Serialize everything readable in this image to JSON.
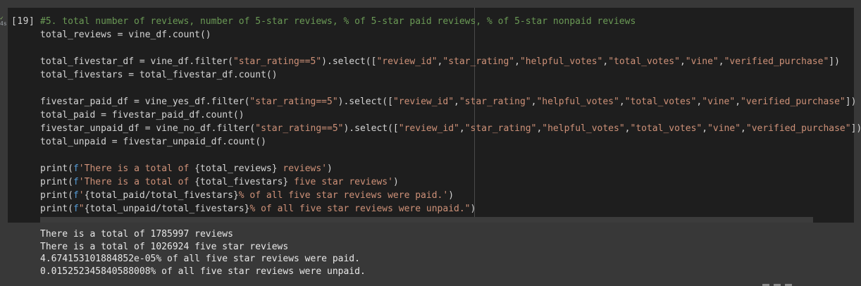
{
  "gutter": {
    "status_mark": "✓",
    "time": "4s"
  },
  "cell": {
    "execution_count": "[19]",
    "code_lines": [
      [
        {
          "t": "comment",
          "v": "#5. total number of reviews, number of 5-star reviews, % of 5-star paid reviews, % of 5-star nonpaid reviews"
        }
      ],
      [
        {
          "t": "var",
          "v": "total_reviews = vine_df.count()"
        }
      ],
      [],
      [
        {
          "t": "var",
          "v": "total_fivestar_df = vine_df.filter("
        },
        {
          "t": "str",
          "v": "\"star_rating==5\""
        },
        {
          "t": "var",
          "v": ").select(["
        },
        {
          "t": "str",
          "v": "\"review_id\""
        },
        {
          "t": "var",
          "v": ","
        },
        {
          "t": "str",
          "v": "\"star_rating\""
        },
        {
          "t": "var",
          "v": ","
        },
        {
          "t": "str",
          "v": "\"helpful_votes\""
        },
        {
          "t": "var",
          "v": ","
        },
        {
          "t": "str",
          "v": "\"total_votes\""
        },
        {
          "t": "var",
          "v": ","
        },
        {
          "t": "str",
          "v": "\"vine\""
        },
        {
          "t": "var",
          "v": ","
        },
        {
          "t": "str",
          "v": "\"verified_purchase\""
        },
        {
          "t": "var",
          "v": "])"
        }
      ],
      [
        {
          "t": "var",
          "v": "total_fivestars = total_fivestar_df.count()"
        }
      ],
      [],
      [
        {
          "t": "var",
          "v": "fivestar_paid_df = vine_yes_df.filter("
        },
        {
          "t": "str",
          "v": "\"star_rating==5\""
        },
        {
          "t": "var",
          "v": ").select(["
        },
        {
          "t": "str",
          "v": "\"review_id\""
        },
        {
          "t": "var",
          "v": ","
        },
        {
          "t": "str",
          "v": "\"star_rating\""
        },
        {
          "t": "var",
          "v": ","
        },
        {
          "t": "str",
          "v": "\"helpful_votes\""
        },
        {
          "t": "var",
          "v": ","
        },
        {
          "t": "str",
          "v": "\"total_votes\""
        },
        {
          "t": "var",
          "v": ","
        },
        {
          "t": "str",
          "v": "\"vine\""
        },
        {
          "t": "var",
          "v": ","
        },
        {
          "t": "str",
          "v": "\"verified_purchase\""
        },
        {
          "t": "var",
          "v": "])"
        }
      ],
      [
        {
          "t": "var",
          "v": "total_paid = fivestar_paid_df.count()"
        }
      ],
      [
        {
          "t": "var",
          "v": "fivestar_unpaid_df = vine_no_df.filter("
        },
        {
          "t": "str",
          "v": "\"star_rating==5\""
        },
        {
          "t": "var",
          "v": ").select(["
        },
        {
          "t": "str",
          "v": "\"review_id\""
        },
        {
          "t": "var",
          "v": ","
        },
        {
          "t": "str",
          "v": "\"star_rating\""
        },
        {
          "t": "var",
          "v": ","
        },
        {
          "t": "str",
          "v": "\"helpful_votes\""
        },
        {
          "t": "var",
          "v": ","
        },
        {
          "t": "str",
          "v": "\"total_votes\""
        },
        {
          "t": "var",
          "v": ","
        },
        {
          "t": "str",
          "v": "\"vine\""
        },
        {
          "t": "var",
          "v": ","
        },
        {
          "t": "str",
          "v": "\"verified_purchase\""
        },
        {
          "t": "var",
          "v": "])"
        }
      ],
      [
        {
          "t": "var",
          "v": "total_unpaid = fivestar_unpaid_df.count()"
        }
      ],
      [],
      [
        {
          "t": "fn",
          "v": "print("
        },
        {
          "t": "prefix",
          "v": "f"
        },
        {
          "t": "str",
          "v": "'There is a total of "
        },
        {
          "t": "var",
          "v": "{total_reviews}"
        },
        {
          "t": "str",
          "v": " reviews'"
        },
        {
          "t": "fn",
          "v": ")"
        }
      ],
      [
        {
          "t": "fn",
          "v": "print("
        },
        {
          "t": "prefix",
          "v": "f"
        },
        {
          "t": "str",
          "v": "'There is a total of "
        },
        {
          "t": "var",
          "v": "{total_fivestars}"
        },
        {
          "t": "str",
          "v": " five star reviews'"
        },
        {
          "t": "fn",
          "v": ")"
        }
      ],
      [
        {
          "t": "fn",
          "v": "print("
        },
        {
          "t": "prefix",
          "v": "f"
        },
        {
          "t": "str",
          "v": "'"
        },
        {
          "t": "var",
          "v": "{total_paid/total_fivestars}"
        },
        {
          "t": "str",
          "v": "% of all five star reviews were paid.'"
        },
        {
          "t": "fn",
          "v": ")"
        }
      ],
      [
        {
          "t": "fn",
          "v": "print("
        },
        {
          "t": "prefix",
          "v": "f"
        },
        {
          "t": "str",
          "v": "\""
        },
        {
          "t": "var",
          "v": "{total_unpaid/total_fivestars}"
        },
        {
          "t": "str",
          "v": "% of all five star reviews were unpaid.\""
        },
        {
          "t": "fn",
          "v": ")"
        }
      ]
    ]
  },
  "output": {
    "lines": [
      "There is a total of 1785997 reviews",
      "There is a total of 1026924 five star reviews",
      "4.674153101884852e-05% of all five star reviews were paid.",
      "0.015252345840588008% of all five star reviews were unpaid."
    ]
  }
}
